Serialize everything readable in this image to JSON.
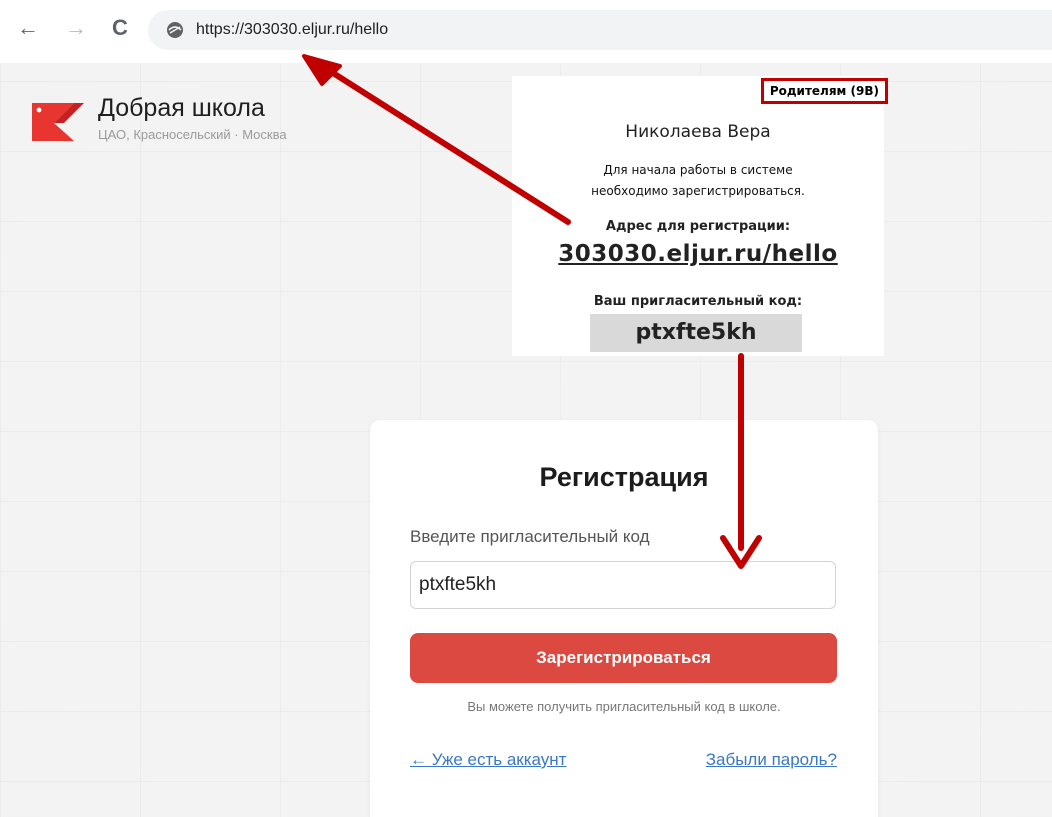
{
  "browser": {
    "url": "https://303030.eljur.ru/hello",
    "back_icon": "←",
    "forward_icon": "→",
    "reload_icon": "C"
  },
  "school": {
    "name": "Добрая школа",
    "location": "ЦАО, Красносельский · Москва"
  },
  "letter": {
    "tag": "Родителям (9В)",
    "name": "Николаева Вера",
    "intro_line1": "Для начала работы в системе",
    "intro_line2": "необходимо зарегистрироваться.",
    "address_label": "Адрес для регистрации:",
    "address": "303030.eljur.ru/hello",
    "code_label": "Ваш пригласительный код:",
    "code": "ptxfte5kh"
  },
  "registration": {
    "title": "Регистрация",
    "code_label": "Введите пригласительный код",
    "code_value": "ptxfte5kh",
    "submit_label": "Зарегистрироваться",
    "hint": "Вы можете получить пригласительный код в школе.",
    "login_link": "← Уже есть аккаунт",
    "forgot_link": "Забыли пароль?"
  },
  "colors": {
    "brand_red": "#dc4941",
    "annotation_red": "#c00000",
    "link_blue": "#3a78c5"
  }
}
